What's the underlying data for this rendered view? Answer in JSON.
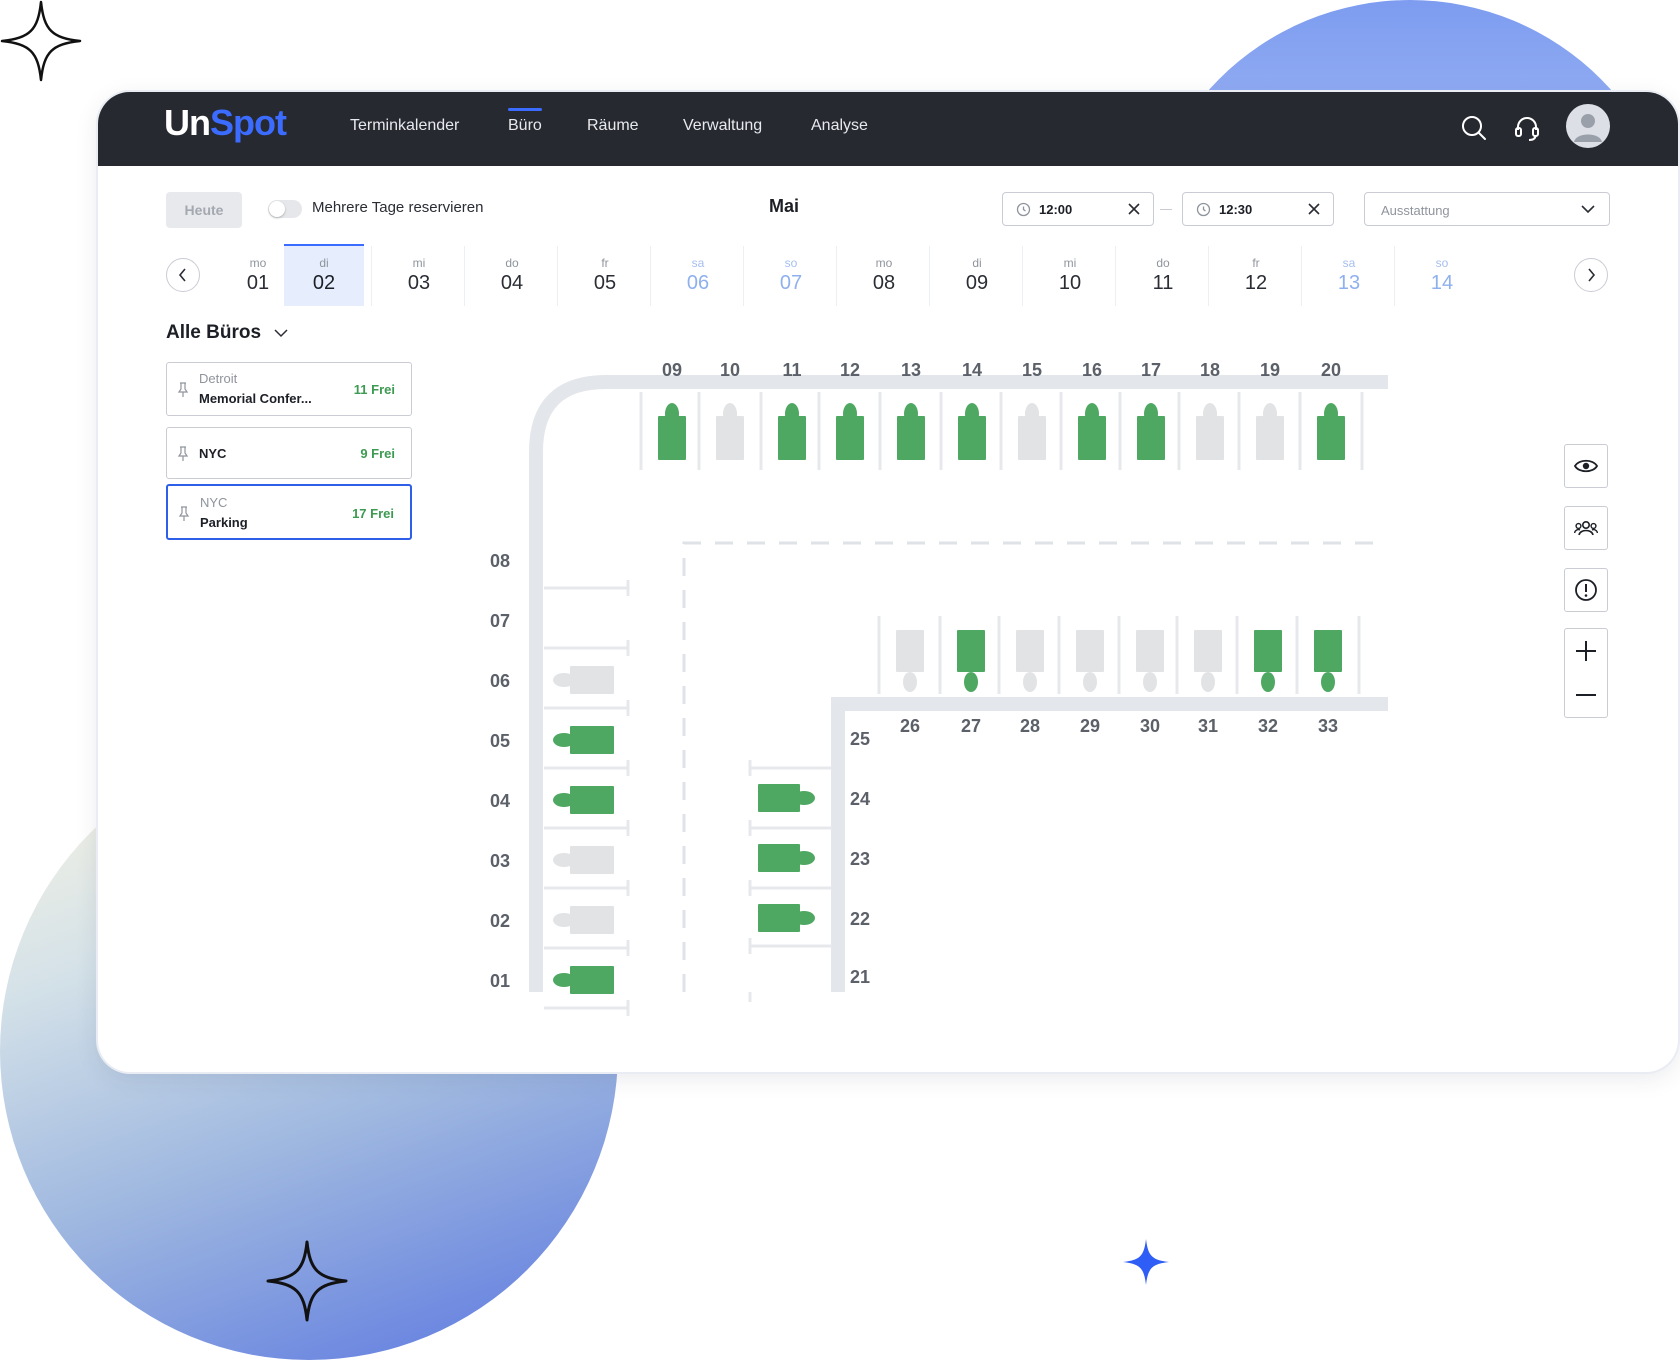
{
  "brand": {
    "part1": "Un",
    "part2": "Spot"
  },
  "nav": {
    "items": [
      {
        "label": "Terminkalender"
      },
      {
        "label": "Büro",
        "active": true
      },
      {
        "label": "Räume"
      },
      {
        "label": "Verwaltung"
      },
      {
        "label": "Analyse"
      }
    ],
    "icons": [
      "search-icon",
      "headset-icon",
      "user-avatar-icon"
    ]
  },
  "toolbar": {
    "today_label": "Heute",
    "multi_day_label": "Mehrere Tage reservieren",
    "multi_day_enabled": false,
    "month": "Mai",
    "time_from": "12:00",
    "time_to": "12:30",
    "equipment_placeholder": "Ausstattung"
  },
  "calendar": {
    "days": [
      {
        "dow": "mo",
        "date": "01",
        "weekend": false,
        "selected": false
      },
      {
        "dow": "di",
        "date": "02",
        "weekend": false,
        "selected": true
      },
      {
        "dow": "mi",
        "date": "03",
        "weekend": false,
        "selected": false
      },
      {
        "dow": "do",
        "date": "04",
        "weekend": false,
        "selected": false
      },
      {
        "dow": "fr",
        "date": "05",
        "weekend": false,
        "selected": false
      },
      {
        "dow": "sa",
        "date": "06",
        "weekend": true,
        "selected": false
      },
      {
        "dow": "so",
        "date": "07",
        "weekend": true,
        "selected": false
      },
      {
        "dow": "mo",
        "date": "08",
        "weekend": false,
        "selected": false
      },
      {
        "dow": "di",
        "date": "09",
        "weekend": false,
        "selected": false
      },
      {
        "dow": "mi",
        "date": "10",
        "weekend": false,
        "selected": false
      },
      {
        "dow": "do",
        "date": "11",
        "weekend": false,
        "selected": false
      },
      {
        "dow": "fr",
        "date": "12",
        "weekend": false,
        "selected": false
      },
      {
        "dow": "sa",
        "date": "13",
        "weekend": true,
        "selected": false
      },
      {
        "dow": "so",
        "date": "14",
        "weekend": true,
        "selected": false
      }
    ]
  },
  "offices": {
    "title": "Alle Büros",
    "items": [
      {
        "city": "Detroit",
        "name": "Memorial Confer...",
        "free": "11 Frei",
        "selected": false
      },
      {
        "city": "",
        "name": "NYC",
        "free": "9 Frei",
        "selected": false
      },
      {
        "city": "NYC",
        "name": "Parking",
        "free": "17 Frei",
        "selected": true
      }
    ]
  },
  "floorplan": {
    "colors": {
      "available": "#4fa862",
      "occupied": "#e2e3e5",
      "wall": "#e3e7eb"
    },
    "top_row": [
      {
        "label": "09",
        "available": true
      },
      {
        "label": "10",
        "available": false
      },
      {
        "label": "11",
        "available": true
      },
      {
        "label": "12",
        "available": true
      },
      {
        "label": "13",
        "available": true
      },
      {
        "label": "14",
        "available": true
      },
      {
        "label": "15",
        "available": false
      },
      {
        "label": "16",
        "available": true
      },
      {
        "label": "17",
        "available": true
      },
      {
        "label": "18",
        "available": false
      },
      {
        "label": "19",
        "available": false
      },
      {
        "label": "20",
        "available": true
      }
    ],
    "middle_row": [
      {
        "label": "26",
        "available": false
      },
      {
        "label": "27",
        "available": true
      },
      {
        "label": "28",
        "available": false
      },
      {
        "label": "29",
        "available": false
      },
      {
        "label": "30",
        "available": false
      },
      {
        "label": "31",
        "available": false
      },
      {
        "label": "32",
        "available": true
      },
      {
        "label": "33",
        "available": true
      }
    ],
    "left_column": [
      {
        "label": "08",
        "available": null
      },
      {
        "label": "07",
        "available": null
      },
      {
        "label": "06",
        "available": false
      },
      {
        "label": "05",
        "available": true
      },
      {
        "label": "04",
        "available": true
      },
      {
        "label": "03",
        "available": false
      },
      {
        "label": "02",
        "available": false
      },
      {
        "label": "01",
        "available": true
      }
    ],
    "right_column": [
      {
        "label": "25",
        "available": null
      },
      {
        "label": "24",
        "available": true
      },
      {
        "label": "23",
        "available": true
      },
      {
        "label": "22",
        "available": true
      },
      {
        "label": "21",
        "available": null
      }
    ]
  },
  "side_tools": [
    "eye-icon",
    "people-icon",
    "alert-icon",
    "zoom-in-icon",
    "zoom-out-icon"
  ]
}
